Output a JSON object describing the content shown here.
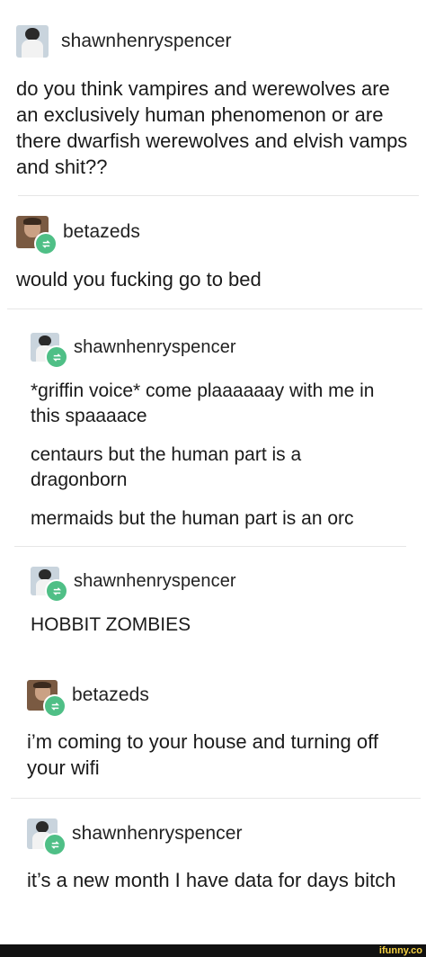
{
  "posts": [
    {
      "username": "shawnhenryspencer",
      "avatar": "shawn-avatar",
      "reblog": false,
      "paragraphs": [
        "do you think vampires and werewolves are an exclusively human phenomenon or are there dwarfish werewolves and elvish vamps and shit??"
      ]
    },
    {
      "username": "betazeds",
      "avatar": "betazeds-avatar",
      "reblog": true,
      "paragraphs": [
        "would you fucking go to bed"
      ]
    },
    {
      "username": "shawnhenryspencer",
      "avatar": "shawn-avatar",
      "reblog": true,
      "paragraphs": [
        "*griffin voice* come plaaaaaay with me in this spaaaace",
        "centaurs but the human part is a dragonborn",
        "mermaids but the human part is an orc"
      ]
    },
    {
      "username": "shawnhenryspencer",
      "avatar": "shawn-avatar",
      "reblog": true,
      "paragraphs": [
        "HOBBIT ZOMBIES"
      ]
    },
    {
      "username": "betazeds",
      "avatar": "betazeds-avatar",
      "reblog": true,
      "paragraphs": [
        "i’m coming to your house and turning off your wifi"
      ]
    },
    {
      "username": "shawnhenryspencer",
      "avatar": "shawn-avatar",
      "reblog": true,
      "paragraphs": [
        "it’s a new month I have data for days bitch"
      ]
    }
  ],
  "watermark": "ifunny.co",
  "colors": {
    "reblog_badge": "#4fbf86",
    "divider": "#e6e6e6",
    "footer": "#111111",
    "watermark": "#f5d142"
  }
}
